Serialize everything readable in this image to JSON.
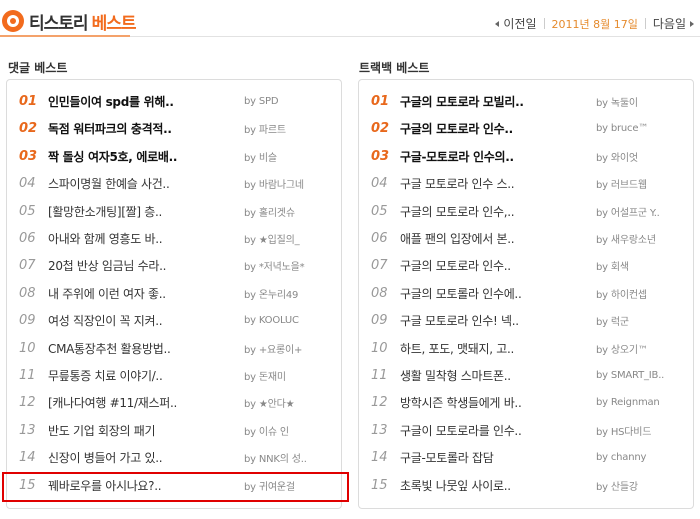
{
  "header": {
    "brand": "티스토리",
    "section": "베스트",
    "prev_label": "이전일",
    "date": "2011년 8월 17일",
    "next_label": "다음일"
  },
  "comment_best": {
    "title": "댓글 베스트",
    "items": [
      {
        "rank": "01",
        "title": "인민들이여 spd를 위해..",
        "author": "by SPD",
        "top": true
      },
      {
        "rank": "02",
        "title": "독점 워터파크의 충격적..",
        "author": "by 파르트",
        "top": true
      },
      {
        "rank": "03",
        "title": "짝 돌싱 여자5호, 에로배..",
        "author": "by 비슬",
        "top": true
      },
      {
        "rank": "04",
        "title": "스파이명월 한예슬 사건..",
        "author": "by 바람나그네",
        "top": false
      },
      {
        "rank": "05",
        "title": "[활망한소개팅][짤] 층..",
        "author": "by 홀리겟슈",
        "top": false
      },
      {
        "rank": "06",
        "title": "아내와 함께 영흥도 바..",
        "author": "by ★입질의_",
        "top": false
      },
      {
        "rank": "07",
        "title": "20첩 반상 임금님 수라..",
        "author": "by *저녁노을*",
        "top": false
      },
      {
        "rank": "08",
        "title": "내 주위에 이런 여자 좋..",
        "author": "by 온누리49",
        "top": false
      },
      {
        "rank": "09",
        "title": "여성 직장인이 꼭 지켜..",
        "author": "by KOOLUC",
        "top": false
      },
      {
        "rank": "10",
        "title": "CMA통장추천 활용방법..",
        "author": "by +요롱이+",
        "top": false
      },
      {
        "rank": "11",
        "title": "무릎통증 치료 이야기/..",
        "author": "by 돈재미",
        "top": false
      },
      {
        "rank": "12",
        "title": "[캐나다여행 #11/재스퍼..",
        "author": "by ★안다★",
        "top": false
      },
      {
        "rank": "13",
        "title": "반도 기업 회장의 패기",
        "author": "by 이슈 인",
        "top": false
      },
      {
        "rank": "14",
        "title": "신장이 병들어 가고 있..",
        "author": "by NNK의 성..",
        "top": false
      },
      {
        "rank": "15",
        "title": "꿰바로우를 아시나요?..",
        "author": "by 귀여운걸",
        "top": false
      }
    ]
  },
  "trackback_best": {
    "title": "트랙백 베스트",
    "items": [
      {
        "rank": "01",
        "title": "구글의 모토로라 모빌리..",
        "author": "by 녹둘이",
        "top": true
      },
      {
        "rank": "02",
        "title": "구글의 모토로라 인수..",
        "author": "by bruce™",
        "top": true
      },
      {
        "rank": "03",
        "title": "구글-모토로라 인수의..",
        "author": "by 와이엇",
        "top": true
      },
      {
        "rank": "04",
        "title": "구글 모토로라 인수 스..",
        "author": "by 러브드웹",
        "top": false
      },
      {
        "rank": "05",
        "title": "구글의 모토로라 인수,..",
        "author": "by 어설프군 Y..",
        "top": false
      },
      {
        "rank": "06",
        "title": "애플 팬의 입장에서 본..",
        "author": "by 새우랑소년",
        "top": false
      },
      {
        "rank": "07",
        "title": "구글의 모토로라 인수..",
        "author": "by 회색",
        "top": false
      },
      {
        "rank": "08",
        "title": "구글의 모토롤라 인수에..",
        "author": "by 하이컨셉",
        "top": false
      },
      {
        "rank": "09",
        "title": "구글 모토로라 인수! 넥..",
        "author": "by 럭군",
        "top": false
      },
      {
        "rank": "10",
        "title": "하트, 포도, 맷돼지, 고..",
        "author": "by 상오기™",
        "top": false
      },
      {
        "rank": "11",
        "title": "생활 밀착형 스마트폰..",
        "author": "by SMART_IB..",
        "top": false
      },
      {
        "rank": "12",
        "title": "방학시즌 학생들에게 바..",
        "author": "by Reignman",
        "top": false
      },
      {
        "rank": "13",
        "title": "구글이 모토로라를 인수..",
        "author": "by HS다비드",
        "top": false
      },
      {
        "rank": "14",
        "title": "구글-모토롤라 잡담",
        "author": "by channy",
        "top": false
      },
      {
        "rank": "15",
        "title": "초록빛 나뭇잎 사이로..",
        "author": "by 산들강",
        "top": false
      }
    ]
  },
  "colors": {
    "accent": "#e8681c",
    "date": "#e58a2c",
    "highlight": "#e00000"
  }
}
